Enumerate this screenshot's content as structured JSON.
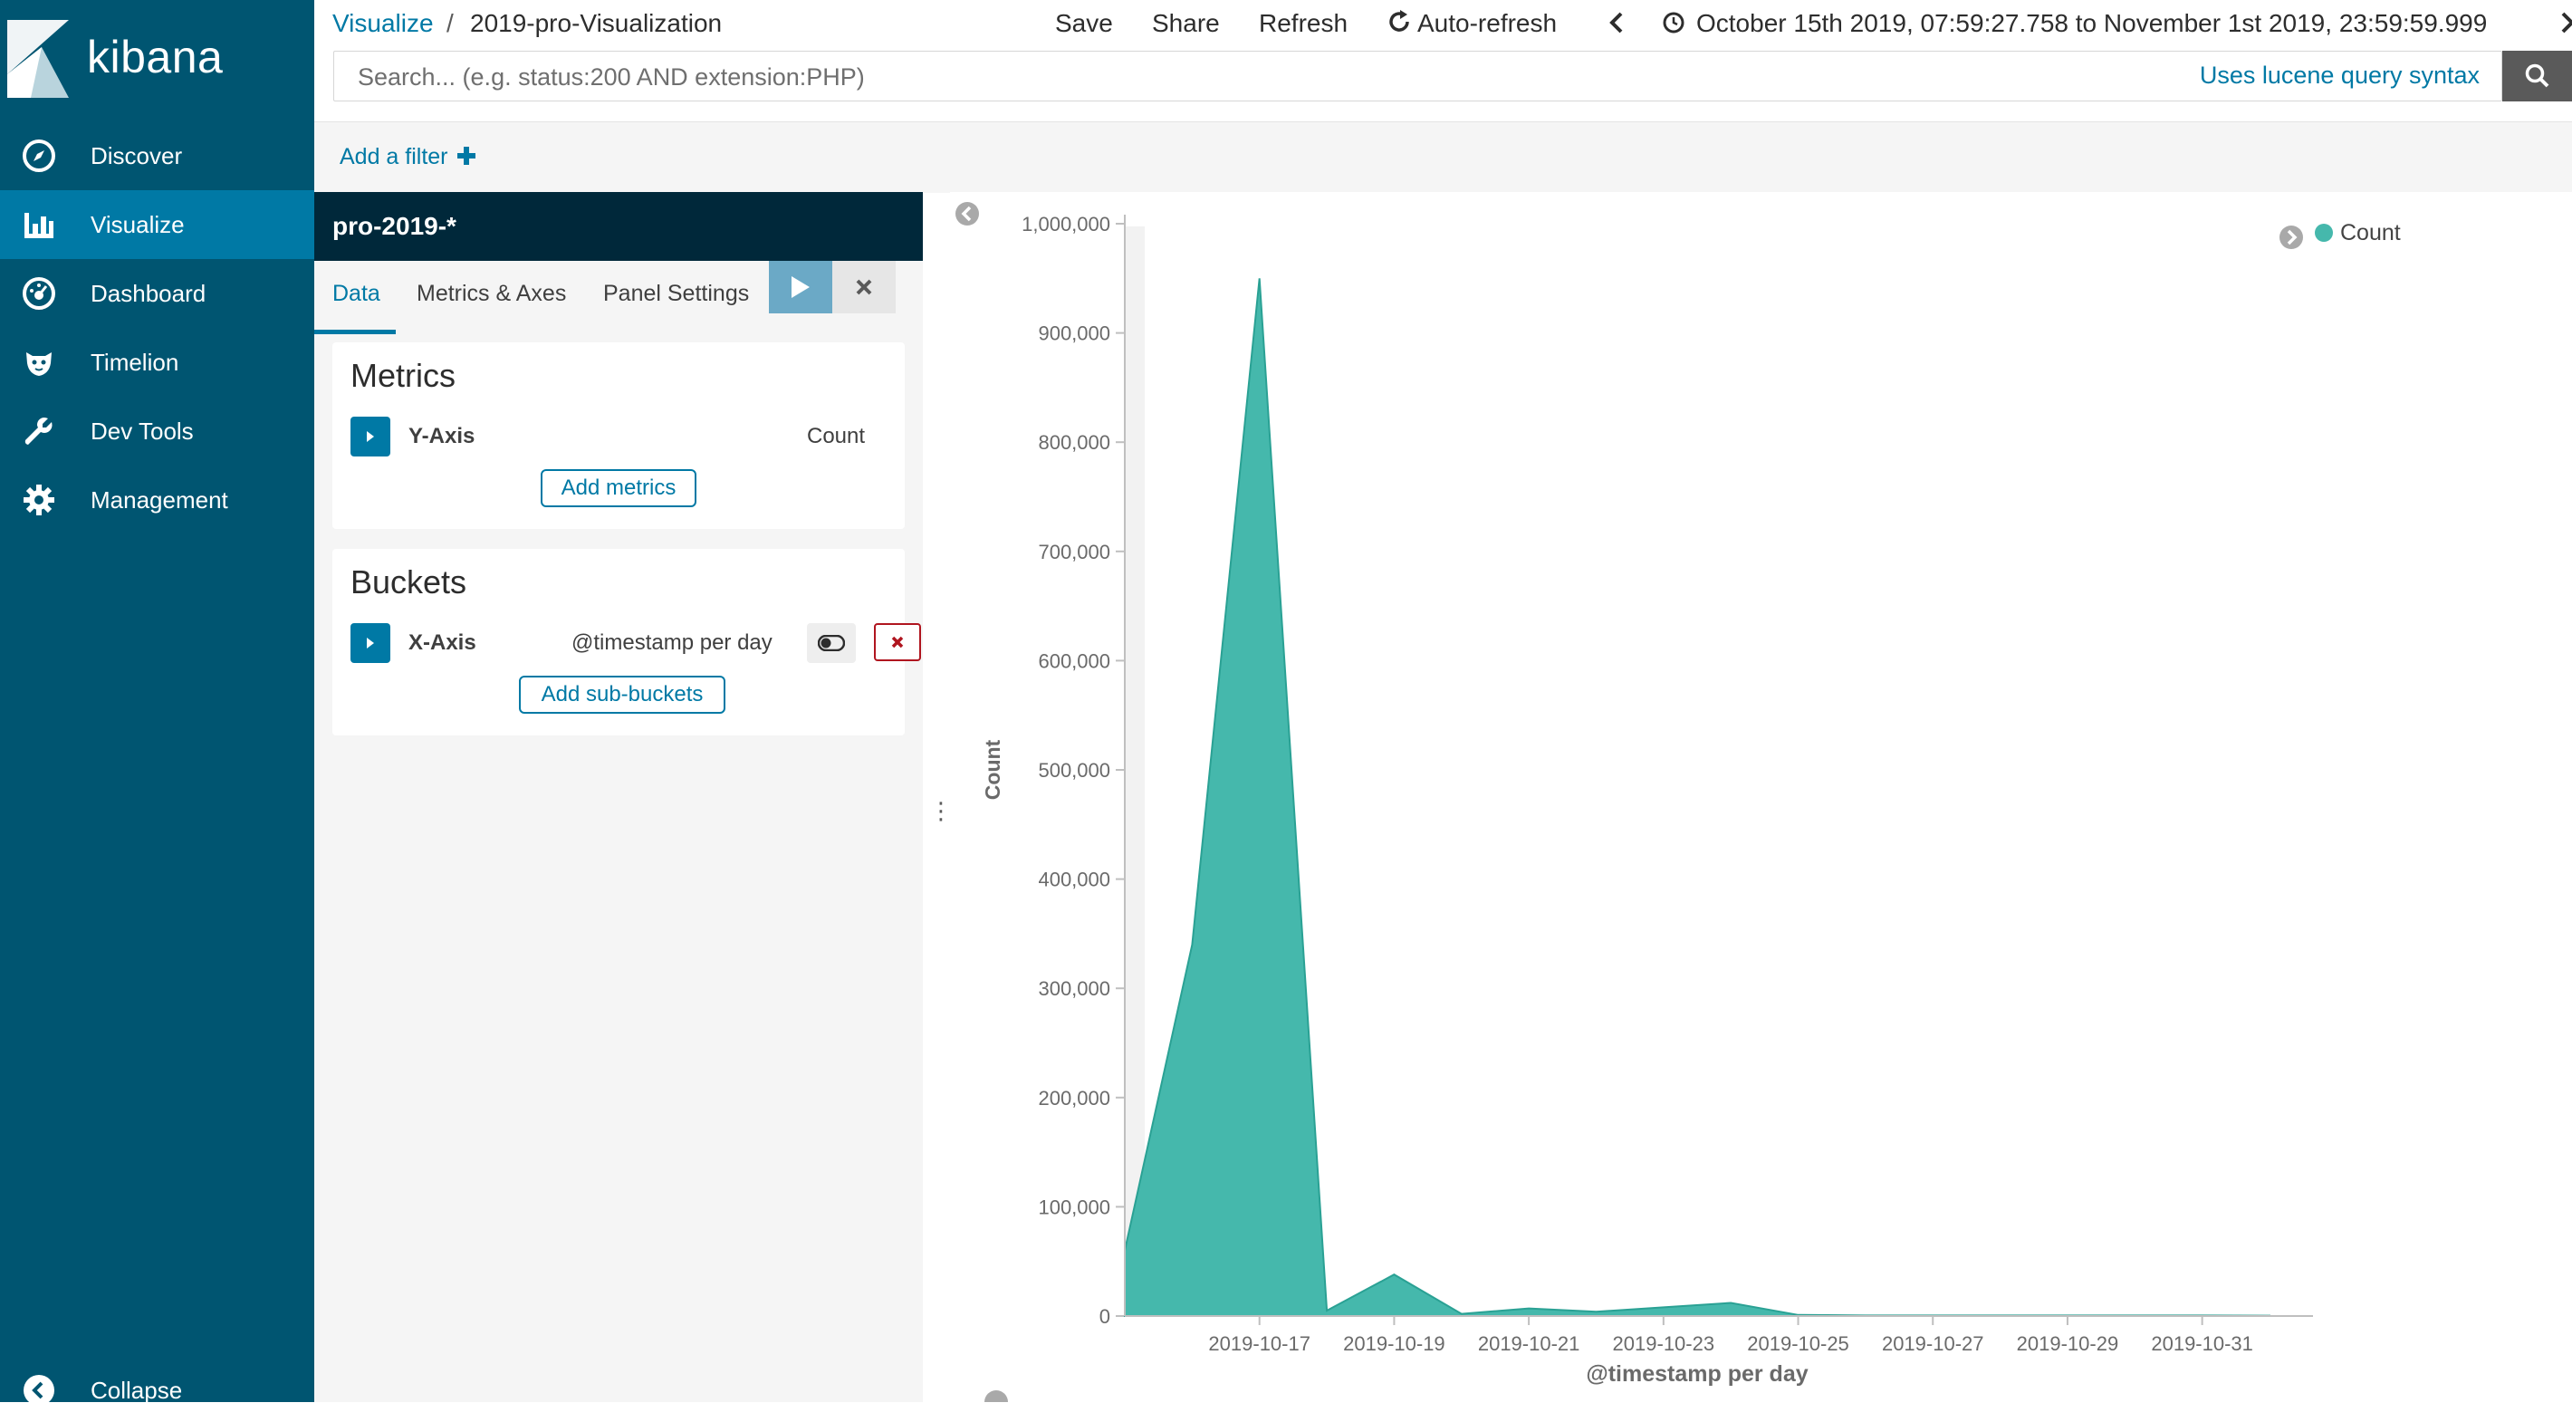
{
  "brand": {
    "name": "kibana"
  },
  "sidebar": {
    "items": [
      {
        "label": "Discover",
        "icon": "compass-icon",
        "active": false
      },
      {
        "label": "Visualize",
        "icon": "bar-chart-icon",
        "active": true
      },
      {
        "label": "Dashboard",
        "icon": "dashboard-icon",
        "active": false
      },
      {
        "label": "Timelion",
        "icon": "timelion-icon",
        "active": false
      },
      {
        "label": "Dev Tools",
        "icon": "wrench-icon",
        "active": false
      },
      {
        "label": "Management",
        "icon": "gear-icon",
        "active": false
      }
    ],
    "collapse_label": "Collapse"
  },
  "breadcrumb": {
    "root": "Visualize",
    "separator": "/",
    "current": "2019-pro-Visualization"
  },
  "toolbar": {
    "save": "Save",
    "share": "Share",
    "refresh": "Refresh",
    "auto_refresh": "Auto-refresh",
    "time_range": "October 15th 2019, 07:59:27.758 to November 1st 2019, 23:59:59.999"
  },
  "search": {
    "placeholder": "Search... (e.g. status:200 AND extension:PHP)",
    "value": "",
    "syntax_link": "Uses lucene query syntax"
  },
  "filters": {
    "add_label": "Add a filter"
  },
  "editor": {
    "index_pattern": "pro-2019-*",
    "tabs": [
      {
        "label": "Data",
        "active": true
      },
      {
        "label": "Metrics & Axes",
        "active": false
      },
      {
        "label": "Panel Settings",
        "active": false
      }
    ],
    "metrics": {
      "title": "Metrics",
      "agg_name": "Y-Axis",
      "agg_desc": "Count",
      "add_button": "Add metrics"
    },
    "buckets": {
      "title": "Buckets",
      "agg_name": "X-Axis",
      "agg_desc": "@timestamp per day",
      "add_button": "Add sub-buckets"
    }
  },
  "colors": {
    "sidebar_bg": "#005571",
    "active_nav": "#0079a5",
    "index_bar": "#00283a",
    "series": "#45b8ac",
    "series_stroke": "#2aa194"
  },
  "chart_data": {
    "type": "area",
    "xlabel": "@timestamp per day",
    "ylabel": "Count",
    "ylim": [
      0,
      1000000
    ],
    "yticks": [
      0,
      100000,
      200000,
      300000,
      400000,
      500000,
      600000,
      700000,
      800000,
      900000,
      1000000
    ],
    "ytick_labels": [
      "0",
      "100,000",
      "200,000",
      "300,000",
      "400,000",
      "500,000",
      "600,000",
      "700,000",
      "800,000",
      "900,000",
      "1,000,000"
    ],
    "xtick_labels": [
      "2019-10-17",
      "2019-10-19",
      "2019-10-21",
      "2019-10-23",
      "2019-10-25",
      "2019-10-27",
      "2019-10-29",
      "2019-10-31"
    ],
    "legend": {
      "position": "top-right",
      "entries": [
        "Count"
      ]
    },
    "series": [
      {
        "name": "Count",
        "x": [
          "2019-10-15",
          "2019-10-16",
          "2019-10-17",
          "2019-10-18",
          "2019-10-19",
          "2019-10-20",
          "2019-10-21",
          "2019-10-22",
          "2019-10-23",
          "2019-10-24",
          "2019-10-25",
          "2019-10-26",
          "2019-10-27",
          "2019-10-28",
          "2019-10-29",
          "2019-10-30",
          "2019-10-31",
          "2019-11-01"
        ],
        "values": [
          60000,
          340000,
          950000,
          5000,
          38000,
          2000,
          7000,
          4000,
          8000,
          12000,
          1000,
          500,
          500,
          500,
          500,
          500,
          500,
          300
        ]
      }
    ]
  }
}
